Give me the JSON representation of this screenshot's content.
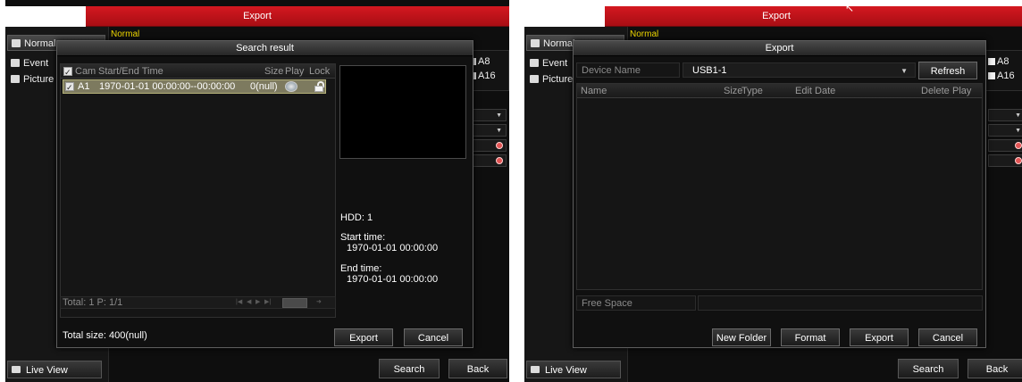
{
  "app": {
    "title": "Export"
  },
  "sidebar": {
    "items": [
      {
        "label": "Normal",
        "icon": "folder-icon"
      },
      {
        "label": "Event",
        "icon": "event-icon"
      },
      {
        "label": "Picture",
        "icon": "picture-icon"
      }
    ],
    "live_view_label": "Live View"
  },
  "background": {
    "normal_tab_label": "Normal",
    "checkbox_a8": "A8",
    "checkbox_a16": "A16",
    "search_label": "Search",
    "back_label": "Back"
  },
  "search_result_dialog": {
    "title": "Search result",
    "columns": {
      "cam": "Cam",
      "time": "Start/End Time",
      "size": "Size",
      "play": "Play",
      "lock": "Lock"
    },
    "rows": [
      {
        "cam": "A1",
        "time": "1970-01-01 00:00:00--00:00:00",
        "size": "0(null)"
      }
    ],
    "pager_text": "Total: 1  P: 1/1",
    "info": {
      "hdd": "HDD: 1",
      "start_label": "Start time:",
      "start_value": "1970-01-01 00:00:00",
      "end_label": "End time:",
      "end_value": "1970-01-01 00:00:00"
    },
    "total_size": "Total size: 400(null)",
    "export_label": "Export",
    "cancel_label": "Cancel"
  },
  "export_dialog": {
    "title": "Export",
    "device_name_label": "Device Name",
    "device_name_value": "USB1-1",
    "refresh_label": "Refresh",
    "columns": {
      "name": "Name",
      "size": "Size",
      "type": "Type",
      "edit_date": "Edit Date",
      "delete": "Delete",
      "play": "Play"
    },
    "free_space_label": "Free Space",
    "new_folder_label": "New Folder",
    "format_label": "Format",
    "export_label": "Export",
    "cancel_label": "Cancel"
  },
  "colors": {
    "titlebar_red": "#c8141c",
    "selected_row": "#7d7a5f",
    "normal_tab_yellow": "#f0d800"
  }
}
